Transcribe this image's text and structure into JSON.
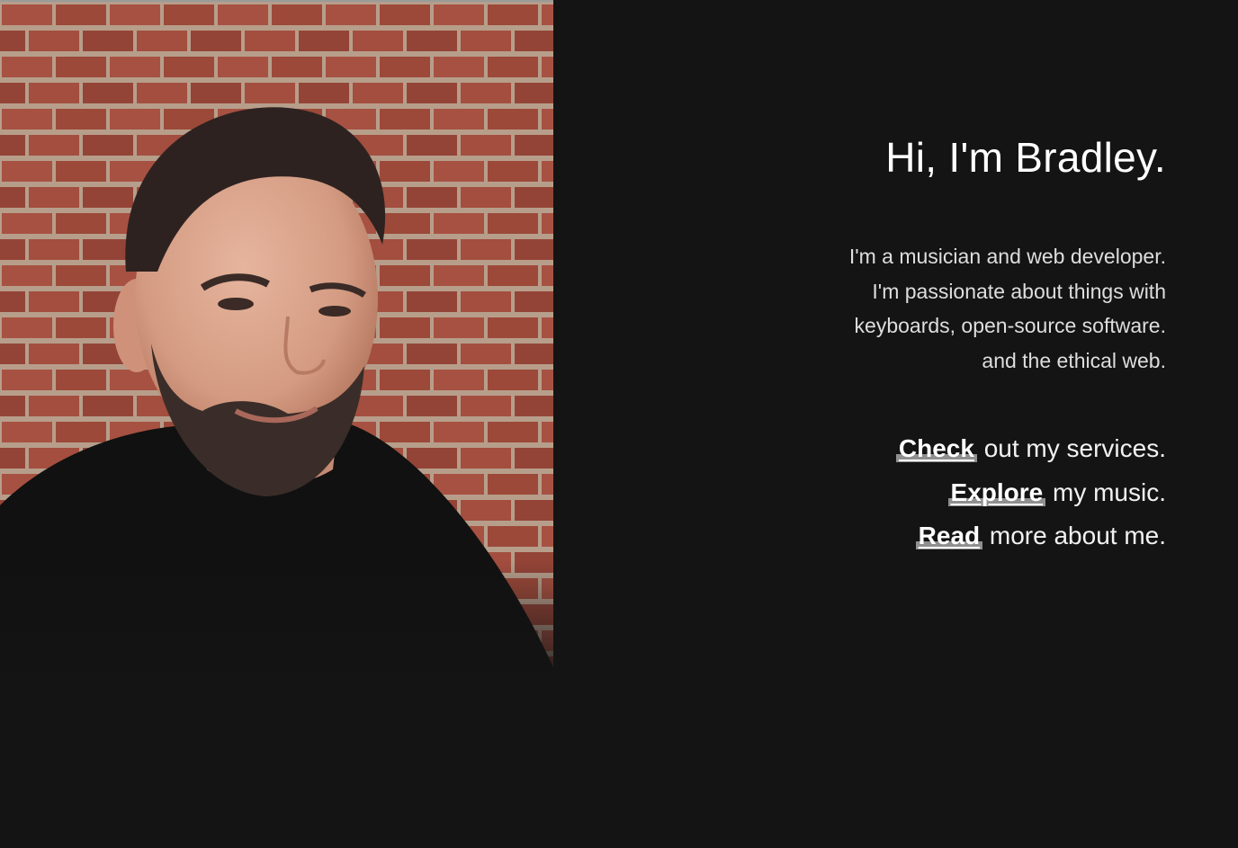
{
  "hero": {
    "title": "Hi, I'm Bradley.",
    "intro_lines": [
      "I'm a musician and web developer.",
      "I'm passionate about things with",
      "keyboards, open-source software.",
      "and the ethical web."
    ]
  },
  "links": [
    {
      "link_text": "Check",
      "rest": " out my services."
    },
    {
      "link_text": "Explore",
      "rest": " my music."
    },
    {
      "link_text": "Read",
      "rest": " more about me."
    }
  ],
  "colors": {
    "background": "#141414",
    "text": "#ffffff",
    "link_highlight": "#8f8f8f"
  }
}
